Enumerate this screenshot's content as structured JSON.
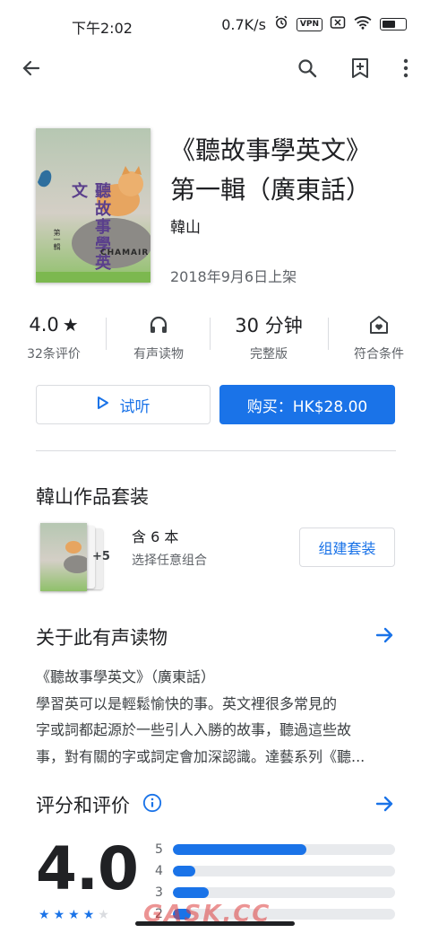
{
  "status": {
    "time": "下午2:02",
    "net_speed": "0.7K/s",
    "vpn": "VPN",
    "battery_level": 0.6
  },
  "app_bar": {
    "icons": [
      "back-arrow-icon",
      "search-icon",
      "bookmark-add-icon",
      "more-vert-icon"
    ]
  },
  "book": {
    "cover_title": "聽故事學英文",
    "cover_vol": "第一輯",
    "cover_publisher": "CHAMAIR",
    "title_line1": "《聽故事學英文》",
    "title_line2": "第一輯（廣東話）",
    "author": "韓山",
    "release": "2018年9月6日上架"
  },
  "stats": {
    "rating_value": "4.0",
    "rating_star": "★",
    "rating_count": "32条评价",
    "audiobook_label": "有声读物",
    "duration_value": "30 分钟",
    "duration_label": "完整版",
    "eligible_label": "符合条件"
  },
  "buttons": {
    "preview": "试听",
    "buy": "购买：HK$28.00"
  },
  "bundle": {
    "title": "韓山作品套装",
    "more_count": "+5",
    "count_text": "含 6 本",
    "sub_text": "选择任意组合",
    "button": "组建套装"
  },
  "about": {
    "title": "关于此有声读物",
    "lines": [
      "《聽故事學英文》（廣東話）",
      "學習英可以是輕鬆愉快的事。英文裡很多常見的",
      "字或詞都起源於一些引人入勝的故事，聽過這些故",
      "事，對有關的字或詞定會加深認識。達藝系列《聽..."
    ]
  },
  "ratings": {
    "title": "评分和评价",
    "big_value": "4.0",
    "stars": [
      "★",
      "★",
      "★",
      "★",
      "★"
    ],
    "histogram": [
      {
        "label": "5",
        "fraction": 0.6
      },
      {
        "label": "4",
        "fraction": 0.1
      },
      {
        "label": "3",
        "fraction": 0.16
      },
      {
        "label": "2",
        "fraction": 0.08
      }
    ]
  },
  "watermark": "GASK.CC",
  "colors": {
    "accent": "#1a73e8",
    "text": "#202124",
    "muted": "#5f6368"
  }
}
